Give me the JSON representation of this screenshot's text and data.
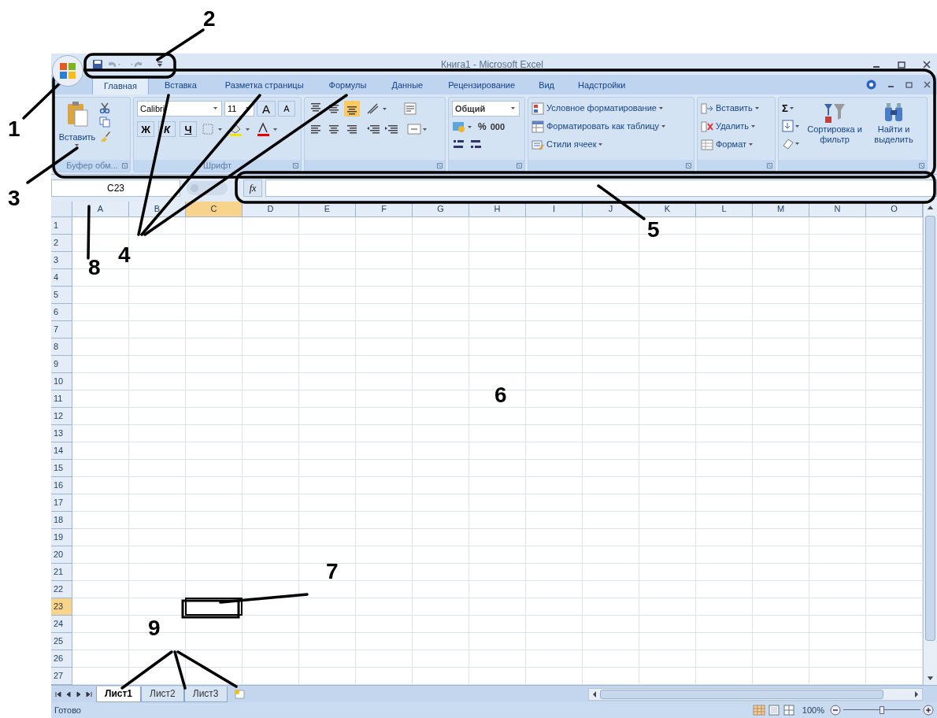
{
  "title_bar": {
    "title": "Книга1 - Microsoft Excel"
  },
  "tabs": [
    {
      "label": "Главная",
      "selected": true
    },
    {
      "label": "Вставка",
      "selected": false
    },
    {
      "label": "Разметка страницы",
      "selected": false
    },
    {
      "label": "Формулы",
      "selected": false
    },
    {
      "label": "Данные",
      "selected": false
    },
    {
      "label": "Рецензирование",
      "selected": false
    },
    {
      "label": "Вид",
      "selected": false
    },
    {
      "label": "Надстройки",
      "selected": false
    }
  ],
  "ribbon": {
    "clipboard": {
      "paste": "Вставить",
      "group": "Буфер обм..."
    },
    "font": {
      "name": "Calibri",
      "size": "11",
      "grow": "A",
      "shrink": "A",
      "bold": "Ж",
      "italic": "К",
      "underline": "Ч",
      "group": "Шрифт"
    },
    "number": {
      "format": "Общий",
      "percent": "%",
      "thousands": "000"
    },
    "styles": [
      "Условное форматирование",
      "Форматировать как таблицу",
      "Стили ячеек"
    ],
    "cells": [
      "Вставить",
      "Удалить",
      "Формат"
    ],
    "editing": {
      "sum": "Σ",
      "sort": "Сортировка и фильтр",
      "find": "Найти и выделить"
    }
  },
  "name_box": "C23",
  "formula_bar": {
    "fx": "fx"
  },
  "grid": {
    "columns": [
      {
        "label": "A",
        "selected": false
      },
      {
        "label": "B",
        "selected": false
      },
      {
        "label": "C",
        "selected": true
      },
      {
        "label": "D",
        "selected": false
      },
      {
        "label": "E",
        "selected": false
      },
      {
        "label": "F",
        "selected": false
      },
      {
        "label": "G",
        "selected": false
      },
      {
        "label": "H",
        "selected": false
      },
      {
        "label": "I",
        "selected": false
      },
      {
        "label": "J",
        "selected": false
      },
      {
        "label": "K",
        "selected": false
      },
      {
        "label": "L",
        "selected": false
      },
      {
        "label": "M",
        "selected": false
      },
      {
        "label": "N",
        "selected": false
      },
      {
        "label": "O",
        "selected": false
      }
    ],
    "rows": [
      {
        "label": "1",
        "selected": false
      },
      {
        "label": "2",
        "selected": false
      },
      {
        "label": "3",
        "selected": false
      },
      {
        "label": "4",
        "selected": false
      },
      {
        "label": "5",
        "selected": false
      },
      {
        "label": "6",
        "selected": false
      },
      {
        "label": "7",
        "selected": false
      },
      {
        "label": "8",
        "selected": false
      },
      {
        "label": "9",
        "selected": false
      },
      {
        "label": "10",
        "selected": false
      },
      {
        "label": "11",
        "selected": false
      },
      {
        "label": "12",
        "selected": false
      },
      {
        "label": "13",
        "selected": false
      },
      {
        "label": "14",
        "selected": false
      },
      {
        "label": "15",
        "selected": false
      },
      {
        "label": "16",
        "selected": false
      },
      {
        "label": "17",
        "selected": false
      },
      {
        "label": "18",
        "selected": false
      },
      {
        "label": "19",
        "selected": false
      },
      {
        "label": "20",
        "selected": false
      },
      {
        "label": "21",
        "selected": false
      },
      {
        "label": "22",
        "selected": false
      },
      {
        "label": "23",
        "selected": true
      },
      {
        "label": "24",
        "selected": false
      },
      {
        "label": "25",
        "selected": false
      },
      {
        "label": "26",
        "selected": false
      },
      {
        "label": "27",
        "selected": false
      }
    ]
  },
  "sheet_tabs": [
    {
      "label": "Лист1",
      "selected": true
    },
    {
      "label": "Лист2",
      "selected": false
    },
    {
      "label": "Лист3",
      "selected": false
    }
  ],
  "status_bar": {
    "status": "Готово",
    "zoom": "100%",
    "zoom_slider": {
      "level": 0.5
    }
  },
  "callouts": [
    {
      "label": "1"
    },
    {
      "label": "2"
    },
    {
      "label": "3"
    },
    {
      "label": "4"
    },
    {
      "label": "5"
    },
    {
      "label": "6"
    },
    {
      "label": "7"
    },
    {
      "label": "8"
    },
    {
      "label": "9"
    }
  ]
}
